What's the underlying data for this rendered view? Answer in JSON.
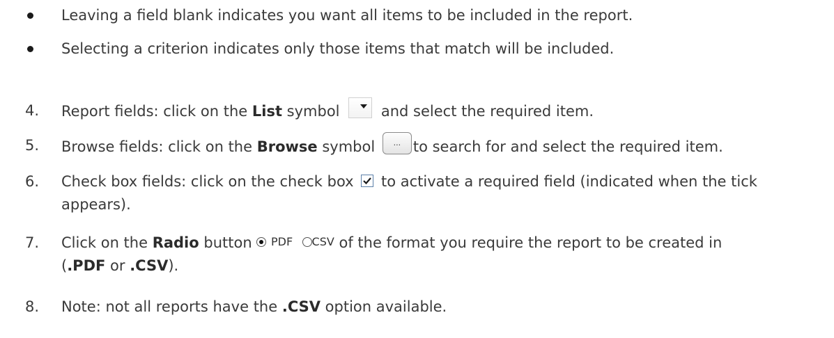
{
  "bullets": [
    "Leaving a field blank indicates you want all items to be included in the report.",
    "Selecting a criterion indicates only those items that match will be included."
  ],
  "steps": {
    "s4": {
      "num": "4.",
      "pre": "Report fields: click on the ",
      "bold": "List",
      "post": " symbol ",
      "tail": " and select the required item.",
      "icon": "dropdown-list-icon"
    },
    "s5": {
      "num": "5.",
      "pre": "Browse fields: click on the ",
      "bold": "Browse",
      "post": " symbol ",
      "tail": "to search for and select the required item.",
      "button_text": "...",
      "icon": "browse-button-icon"
    },
    "s6": {
      "num": "6.",
      "pre": "Check box fields: click on the check box ",
      "tail": " to activate a required field (indicated when the tick",
      "line2": "appears).",
      "icon": "checkbox-checked-icon"
    },
    "s7": {
      "num": "7.",
      "pre": "Click on the ",
      "bold": "Radio",
      "post": " button ",
      "radio1": "PDF",
      "radio2": "CSV",
      "tail": " of the format you require the report to be created in",
      "line2_a": "(",
      "line2_b": ".PDF",
      "line2_c": " or ",
      "line2_d": ".CSV",
      "line2_e": ")."
    },
    "s8": {
      "num": "8.",
      "pre": "Note: not all reports have the ",
      "bold": ".CSV",
      "tail": " option available."
    }
  }
}
